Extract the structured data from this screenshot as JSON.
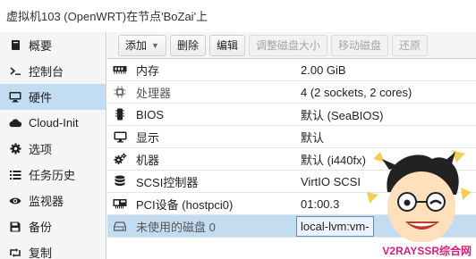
{
  "window": {
    "title": "虚拟机103 (OpenWRT)在节点'BoZai'上"
  },
  "sidebar": {
    "items": [
      {
        "label": "概要",
        "icon": "book-icon"
      },
      {
        "label": "控制台",
        "icon": "terminal-icon"
      },
      {
        "label": "硬件",
        "icon": "monitor-icon",
        "active": true
      },
      {
        "label": "Cloud-Init",
        "icon": "cloud-icon"
      },
      {
        "label": "选项",
        "icon": "gear-icon"
      },
      {
        "label": "任务历史",
        "icon": "list-icon"
      },
      {
        "label": "监视器",
        "icon": "eye-icon"
      },
      {
        "label": "备份",
        "icon": "floppy-icon"
      },
      {
        "label": "复制",
        "icon": "retweet-icon"
      }
    ]
  },
  "toolbar": {
    "add_label": "添加",
    "delete_label": "删除",
    "edit_label": "编辑",
    "resize_label": "调整磁盘大小",
    "move_label": "移动磁盘",
    "revert_label": "还原"
  },
  "hardware": {
    "rows": [
      {
        "key": "内存",
        "value": "2.00 GiB",
        "icon": "memory-icon"
      },
      {
        "key": "处理器",
        "value": "4 (2 sockets, 2 cores)",
        "icon": "cpu-icon"
      },
      {
        "key": "BIOS",
        "value": "默认 (SeaBIOS)",
        "icon": "microchip-icon"
      },
      {
        "key": "显示",
        "value": "默认",
        "icon": "desktop-icon"
      },
      {
        "key": "机器",
        "value": "默认 (i440fx)",
        "icon": "cogs-icon"
      },
      {
        "key": "SCSI控制器",
        "value": "VirtIO SCSI",
        "icon": "database-icon"
      },
      {
        "key": "PCI设备 (hostpci0)",
        "value": "01:00.3",
        "icon": "pci-card-icon"
      },
      {
        "key": "未使用的磁盘 0",
        "value": "local-lvm:vm-",
        "icon": "hdd-icon",
        "selected": true
      }
    ]
  },
  "watermark": {
    "text": "V2RAYSSR综合网"
  },
  "colors": {
    "selection": "#c2ddf2",
    "sidebar_bg": "#f5f5f5",
    "watermark": "#d91e7a"
  }
}
